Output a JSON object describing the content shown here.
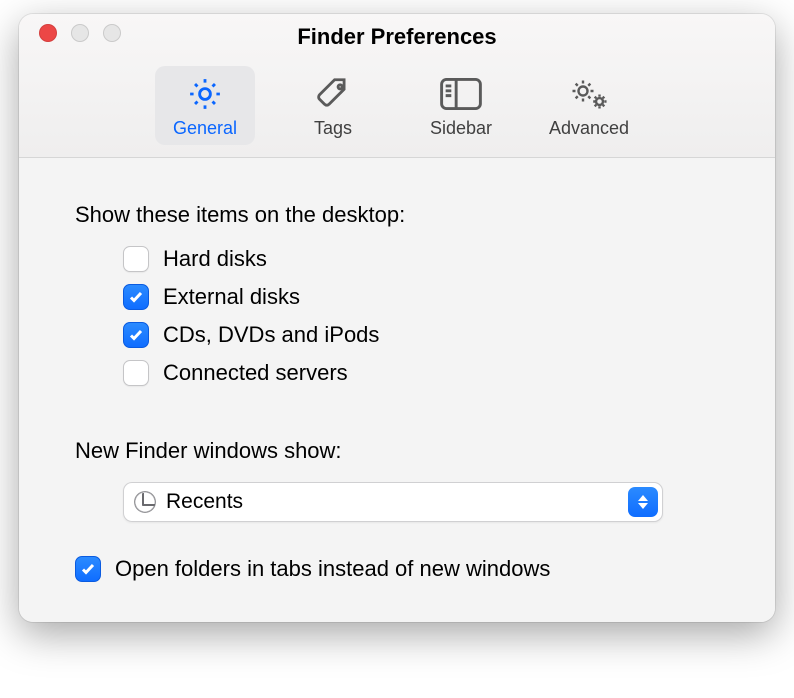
{
  "window": {
    "title": "Finder Preferences"
  },
  "toolbar": {
    "items": [
      {
        "label": "General",
        "active": true
      },
      {
        "label": "Tags",
        "active": false
      },
      {
        "label": "Sidebar",
        "active": false
      },
      {
        "label": "Advanced",
        "active": false
      }
    ]
  },
  "content": {
    "desktop_items_heading": "Show these items on the desktop:",
    "desktop_items": [
      {
        "label": "Hard disks",
        "checked": false
      },
      {
        "label": "External disks",
        "checked": true
      },
      {
        "label": "CDs, DVDs and iPods",
        "checked": true
      },
      {
        "label": "Connected servers",
        "checked": false
      }
    ],
    "new_finder_heading": "New Finder windows show:",
    "new_finder_popup": {
      "value": "Recents"
    },
    "open_tabs": {
      "label": "Open folders in tabs instead of new windows",
      "checked": true
    }
  }
}
